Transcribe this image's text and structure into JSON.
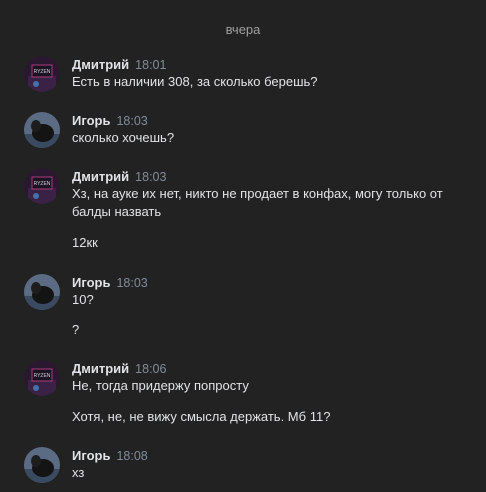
{
  "date_separator": "вчера",
  "messages": [
    {
      "author": "Дмитрий",
      "time": "18:01",
      "lines": [
        "Есть в наличии 308, за сколько берешь?"
      ]
    },
    {
      "author": "Игорь",
      "time": "18:03",
      "lines": [
        "сколько хочешь?"
      ]
    },
    {
      "author": "Дмитрий",
      "time": "18:03",
      "lines": [
        "Хз, на ауке их нет, никто не продает в конфах, могу только от",
        "балды назвать",
        "12кк"
      ]
    },
    {
      "author": "Игорь",
      "time": "18:03",
      "lines": [
        "10?",
        "?"
      ]
    },
    {
      "author": "Дмитрий",
      "time": "18:06",
      "lines": [
        "Не, тогда придержу попросту",
        "Хотя, не, не вижу смысла держать. Мб 11?"
      ]
    },
    {
      "author": "Игорь",
      "time": "18:08",
      "lines": [
        "хз"
      ]
    }
  ],
  "avatars": {
    "dmitry": {
      "label": "RYZEN"
    }
  },
  "colors": {
    "background": "#222222",
    "text": "#e1e3e6",
    "muted": "#818c99"
  }
}
